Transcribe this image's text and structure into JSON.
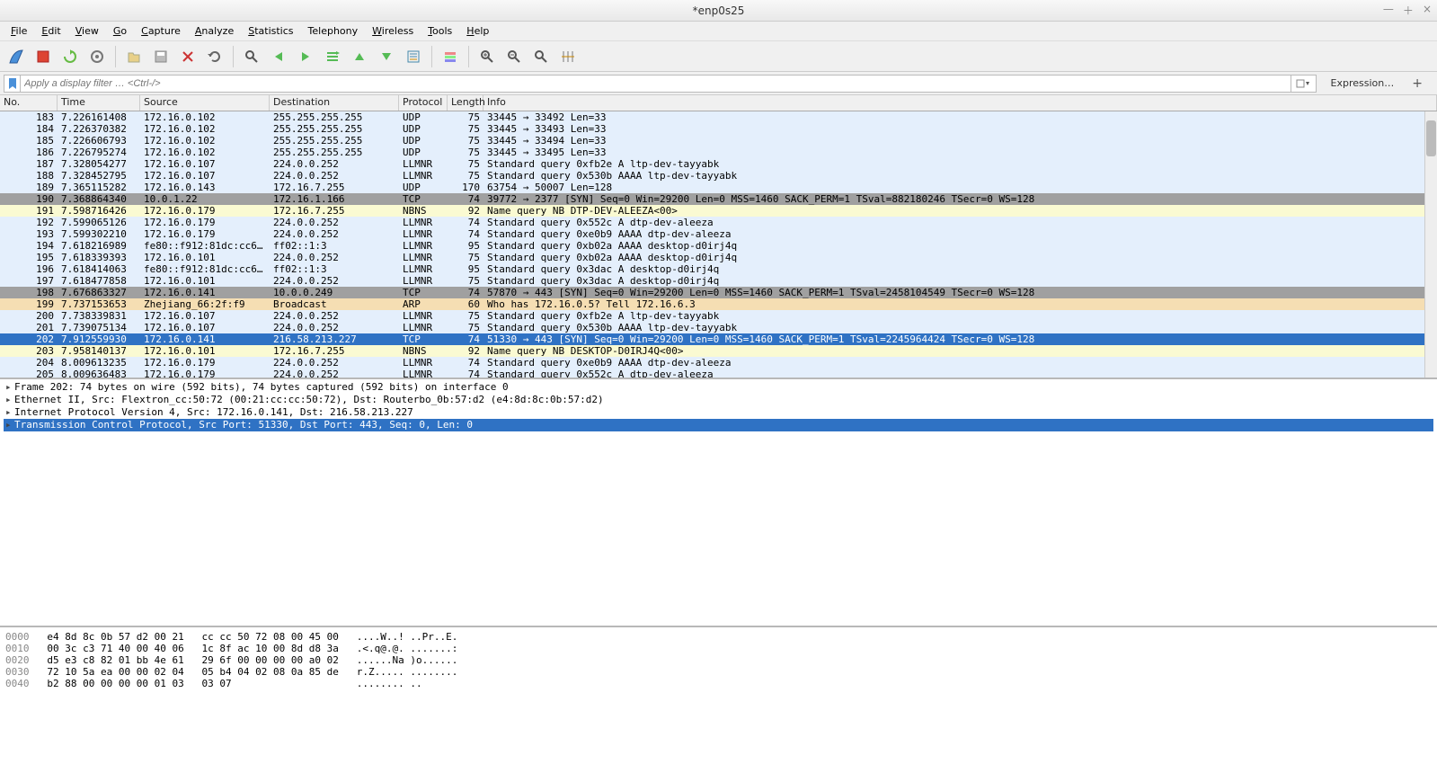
{
  "title": "*enp0s25",
  "menus": [
    {
      "key": "file",
      "u": "F",
      "rest": "ile"
    },
    {
      "key": "edit",
      "u": "E",
      "rest": "dit"
    },
    {
      "key": "view",
      "u": "V",
      "rest": "iew"
    },
    {
      "key": "go",
      "u": "G",
      "rest": "o"
    },
    {
      "key": "capture",
      "u": "C",
      "rest": "apture"
    },
    {
      "key": "analyze",
      "u": "A",
      "rest": "nalyze"
    },
    {
      "key": "statistics",
      "u": "S",
      "rest": "tatistics"
    },
    {
      "key": "telephony",
      "u": "",
      "rest": "Telephony"
    },
    {
      "key": "wireless",
      "u": "W",
      "rest": "ireless"
    },
    {
      "key": "tools",
      "u": "T",
      "rest": "ools"
    },
    {
      "key": "help",
      "u": "H",
      "rest": "elp"
    }
  ],
  "filter_placeholder": "Apply a display filter … <Ctrl-/>",
  "expression_label": "Expression…",
  "columns": {
    "no": "No.",
    "time": "Time",
    "source": "Source",
    "destination": "Destination",
    "protocol": "Protocol",
    "length": "Length",
    "info": "Info"
  },
  "rows": [
    {
      "no": "183",
      "time": "7.226161408",
      "src": "172.16.0.102",
      "dst": "255.255.255.255",
      "proto": "UDP",
      "len": "75",
      "info": "33445 → 33492 Len=33",
      "bg": "lightblue"
    },
    {
      "no": "184",
      "time": "7.226370382",
      "src": "172.16.0.102",
      "dst": "255.255.255.255",
      "proto": "UDP",
      "len": "75",
      "info": "33445 → 33493 Len=33",
      "bg": "lightblue"
    },
    {
      "no": "185",
      "time": "7.226606793",
      "src": "172.16.0.102",
      "dst": "255.255.255.255",
      "proto": "UDP",
      "len": "75",
      "info": "33445 → 33494 Len=33",
      "bg": "lightblue"
    },
    {
      "no": "186",
      "time": "7.226795274",
      "src": "172.16.0.102",
      "dst": "255.255.255.255",
      "proto": "UDP",
      "len": "75",
      "info": "33445 → 33495 Len=33",
      "bg": "lightblue"
    },
    {
      "no": "187",
      "time": "7.328054277",
      "src": "172.16.0.107",
      "dst": "224.0.0.252",
      "proto": "LLMNR",
      "len": "75",
      "info": "Standard query 0xfb2e A ltp-dev-tayyabk",
      "bg": "lightblue"
    },
    {
      "no": "188",
      "time": "7.328452795",
      "src": "172.16.0.107",
      "dst": "224.0.0.252",
      "proto": "LLMNR",
      "len": "75",
      "info": "Standard query 0x530b AAAA ltp-dev-tayyabk",
      "bg": "lightblue"
    },
    {
      "no": "189",
      "time": "7.365115282",
      "src": "172.16.0.143",
      "dst": "172.16.7.255",
      "proto": "UDP",
      "len": "170",
      "info": "63754 → 50007 Len=128",
      "bg": "lightblue"
    },
    {
      "no": "190",
      "time": "7.368864340",
      "src": "10.0.1.22",
      "dst": "172.16.1.166",
      "proto": "TCP",
      "len": "74",
      "info": "39772 → 2377 [SYN] Seq=0 Win=29200 Len=0 MSS=1460 SACK_PERM=1 TSval=882180246 TSecr=0 WS=128",
      "bg": "gray"
    },
    {
      "no": "191",
      "time": "7.598716426",
      "src": "172.16.0.179",
      "dst": "172.16.7.255",
      "proto": "NBNS",
      "len": "92",
      "info": "Name query NB DTP-DEV-ALEEZA<00>",
      "bg": "yellow"
    },
    {
      "no": "192",
      "time": "7.599065126",
      "src": "172.16.0.179",
      "dst": "224.0.0.252",
      "proto": "LLMNR",
      "len": "74",
      "info": "Standard query 0x552c A dtp-dev-aleeza",
      "bg": "lightblue"
    },
    {
      "no": "193",
      "time": "7.599302210",
      "src": "172.16.0.179",
      "dst": "224.0.0.252",
      "proto": "LLMNR",
      "len": "74",
      "info": "Standard query 0xe0b9 AAAA dtp-dev-aleeza",
      "bg": "lightblue"
    },
    {
      "no": "194",
      "time": "7.618216989",
      "src": "fe80::f912:81dc:cc6…",
      "dst": "ff02::1:3",
      "proto": "LLMNR",
      "len": "95",
      "info": "Standard query 0xb02a AAAA desktop-d0irj4q",
      "bg": "lightblue"
    },
    {
      "no": "195",
      "time": "7.618339393",
      "src": "172.16.0.101",
      "dst": "224.0.0.252",
      "proto": "LLMNR",
      "len": "75",
      "info": "Standard query 0xb02a AAAA desktop-d0irj4q",
      "bg": "lightblue"
    },
    {
      "no": "196",
      "time": "7.618414063",
      "src": "fe80::f912:81dc:cc6…",
      "dst": "ff02::1:3",
      "proto": "LLMNR",
      "len": "95",
      "info": "Standard query 0x3dac A desktop-d0irj4q",
      "bg": "lightblue"
    },
    {
      "no": "197",
      "time": "7.618477858",
      "src": "172.16.0.101",
      "dst": "224.0.0.252",
      "proto": "LLMNR",
      "len": "75",
      "info": "Standard query 0x3dac A desktop-d0irj4q",
      "bg": "lightblue"
    },
    {
      "no": "198",
      "time": "7.676863327",
      "src": "172.16.0.141",
      "dst": "10.0.0.249",
      "proto": "TCP",
      "len": "74",
      "info": "57870 → 443 [SYN] Seq=0 Win=29200 Len=0 MSS=1460 SACK_PERM=1 TSval=2458104549 TSecr=0 WS=128",
      "bg": "gray"
    },
    {
      "no": "199",
      "time": "7.737153653",
      "src": "Zhejiang_66:2f:f9",
      "dst": "Broadcast",
      "proto": "ARP",
      "len": "60",
      "info": "Who has 172.16.0.5? Tell 172.16.6.3",
      "bg": "wheat"
    },
    {
      "no": "200",
      "time": "7.738339831",
      "src": "172.16.0.107",
      "dst": "224.0.0.252",
      "proto": "LLMNR",
      "len": "75",
      "info": "Standard query 0xfb2e A ltp-dev-tayyabk",
      "bg": "lightblue"
    },
    {
      "no": "201",
      "time": "7.739075134",
      "src": "172.16.0.107",
      "dst": "224.0.0.252",
      "proto": "LLMNR",
      "len": "75",
      "info": "Standard query 0x530b AAAA ltp-dev-tayyabk",
      "bg": "lightblue"
    },
    {
      "no": "202",
      "time": "7.912559930",
      "src": "172.16.0.141",
      "dst": "216.58.213.227",
      "proto": "TCP",
      "len": "74",
      "info": "51330 → 443 [SYN] Seq=0 Win=29200 Len=0 MSS=1460 SACK_PERM=1 TSval=2245964424 TSecr=0 WS=128",
      "bg": "selected"
    },
    {
      "no": "203",
      "time": "7.958140137",
      "src": "172.16.0.101",
      "dst": "172.16.7.255",
      "proto": "NBNS",
      "len": "92",
      "info": "Name query NB DESKTOP-D0IRJ4Q<00>",
      "bg": "yellow"
    },
    {
      "no": "204",
      "time": "8.009613235",
      "src": "172.16.0.179",
      "dst": "224.0.0.252",
      "proto": "LLMNR",
      "len": "74",
      "info": "Standard query 0xe0b9 AAAA dtp-dev-aleeza",
      "bg": "lightblue"
    },
    {
      "no": "205",
      "time": "8.009636483",
      "src": "172.16.0.179",
      "dst": "224.0.0.252",
      "proto": "LLMNR",
      "len": "74",
      "info": "Standard query 0x552c A dtp-dev-aleeza",
      "bg": "lightblue"
    }
  ],
  "details": [
    {
      "text": "Frame 202: 74 bytes on wire (592 bits), 74 bytes captured (592 bits) on interface 0",
      "sel": false
    },
    {
      "text": "Ethernet II, Src: Flextron_cc:50:72 (00:21:cc:cc:50:72), Dst: Routerbo_0b:57:d2 (e4:8d:8c:0b:57:d2)",
      "sel": false
    },
    {
      "text": "Internet Protocol Version 4, Src: 172.16.0.141, Dst: 216.58.213.227",
      "sel": false
    },
    {
      "text": "Transmission Control Protocol, Src Port: 51330, Dst Port: 443, Seq: 0, Len: 0",
      "sel": true
    }
  ],
  "hex": [
    {
      "off": "0000",
      "b1": "e4 8d 8c 0b 57 d2 00 21",
      "b2": "cc cc 50 72 08 00 45 00",
      "a": "....W..! ..Pr..E."
    },
    {
      "off": "0010",
      "b1": "00 3c c3 71 40 00 40 06",
      "b2": "1c 8f ac 10 00 8d d8 3a",
      "a": ".<.q@.@. .......:"
    },
    {
      "off": "0020",
      "b1": "d5 e3 c8 82 01 bb 4e 61",
      "b2": "29 6f 00 00 00 00 a0 02",
      "a": "......Na )o......"
    },
    {
      "off": "0030",
      "b1": "72 10 5a ea 00 00 02 04",
      "b2": "05 b4 04 02 08 0a 85 de",
      "a": "r.Z..... ........"
    },
    {
      "off": "0040",
      "b1": "b2 88 00 00 00 00 01 03",
      "b2": "03 07",
      "a": "........ .."
    }
  ]
}
